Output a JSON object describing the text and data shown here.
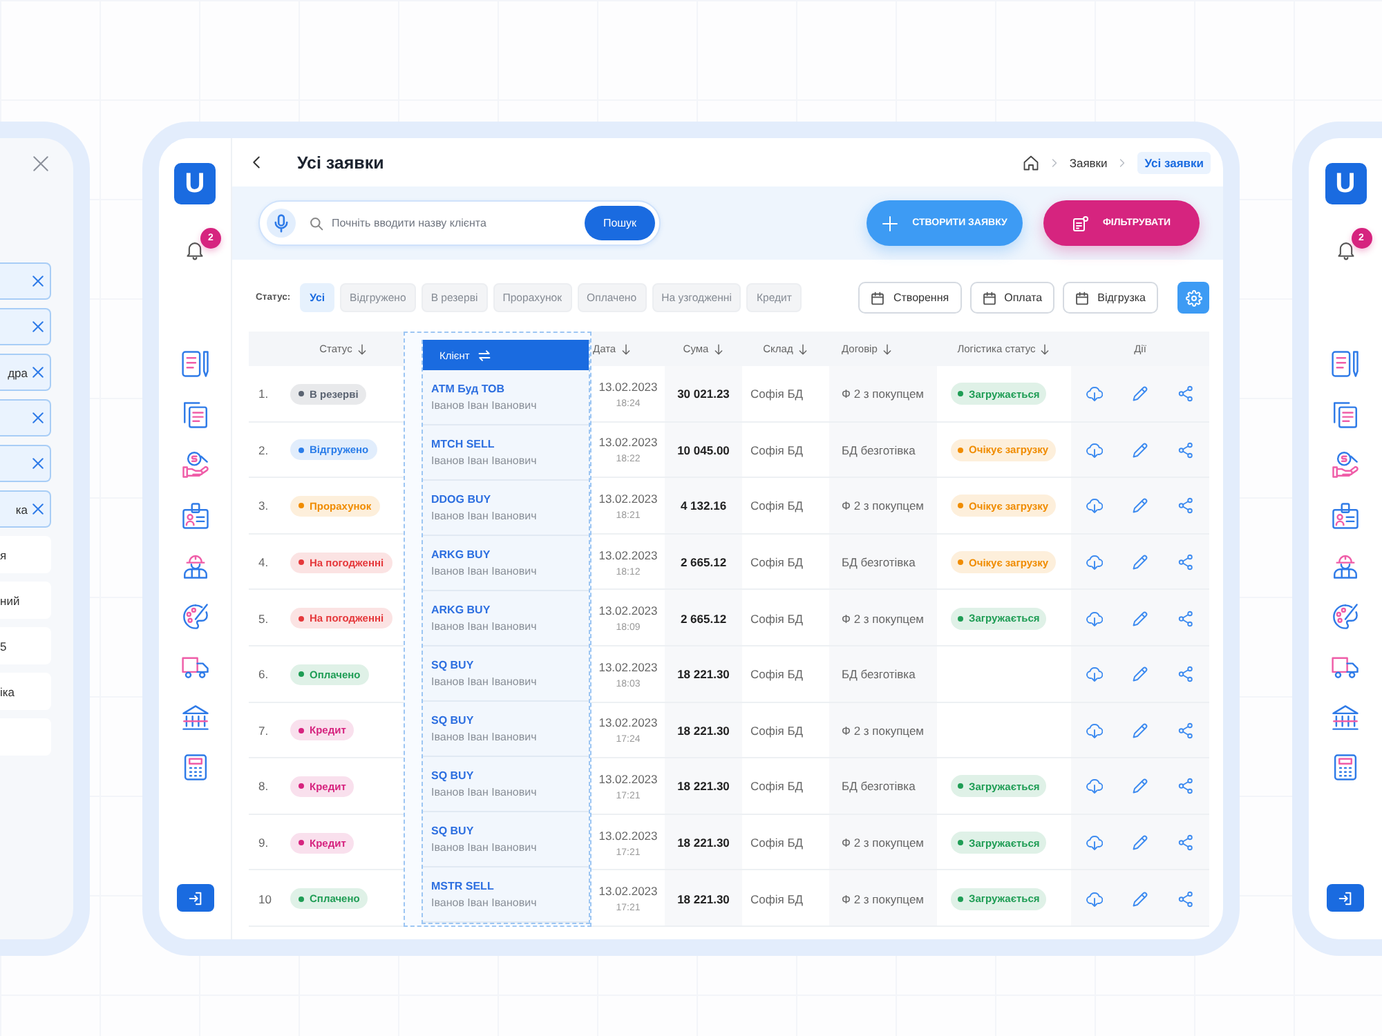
{
  "left_panel": {
    "options": [
      {
        "selected": true
      },
      {
        "selected": true
      },
      {
        "label": "дра",
        "selected": true
      },
      {
        "selected": true
      },
      {
        "selected": true
      },
      {
        "label": "ка",
        "selected": true
      },
      {
        "label": "я",
        "selected": false
      },
      {
        "label": "ний",
        "selected": false
      },
      {
        "label": "5",
        "selected": false
      },
      {
        "label": "іка",
        "selected": false
      },
      {
        "selected": false
      }
    ]
  },
  "sidebar": {
    "logo": "U",
    "notification_count": "2"
  },
  "header": {
    "title": "Усі заявки",
    "breadcrumbs": [
      {
        "label": "Заявки",
        "selected": false
      },
      {
        "label": "Усі заявки",
        "selected": true
      }
    ]
  },
  "search": {
    "placeholder": "Почніть вводити назву клієнта",
    "button": "Пошук"
  },
  "actions": [
    {
      "label": "СТВОРИТИ ЗАЯВКУ",
      "kind": "create"
    },
    {
      "label": "ФІЛЬТРУВАТИ",
      "kind": "filter"
    }
  ],
  "status_filter": {
    "label": "Статус:",
    "options": [
      {
        "label": "Усі",
        "selected": true
      },
      {
        "label": "Відгружено",
        "selected": false
      },
      {
        "label": "В резерві",
        "selected": false
      },
      {
        "label": "Прорахунок",
        "selected": false
      },
      {
        "label": "Оплачено",
        "selected": false
      },
      {
        "label": "На узгодженні",
        "selected": false
      },
      {
        "label": "Кредит",
        "selected": false
      }
    ]
  },
  "date_filters": [
    "Створення",
    "Оплата",
    "Відгрузка"
  ],
  "table": {
    "columns": [
      {
        "label": "Статус",
        "kind": "sort"
      },
      {
        "label": "Клієнт",
        "kind": "drag"
      },
      {
        "label": "Дата",
        "kind": "sort"
      },
      {
        "label": "Сума",
        "kind": "sort"
      },
      {
        "label": "Склад",
        "kind": "sort"
      },
      {
        "label": "Договір",
        "kind": "sort"
      },
      {
        "label": "Логістика статус",
        "kind": "sort"
      },
      {
        "label": "Дії",
        "kind": "plain"
      }
    ],
    "rows": [
      {
        "number": "1.",
        "status": {
          "label": "В резерві",
          "color": "#5b6472"
        },
        "client": "АТМ Буд ТОВ",
        "contact": "Іванов Іван Іванович",
        "date": "13.02.2023",
        "time": "18:24",
        "sum": "30 021.23",
        "warehouse": "Софія БД",
        "contract": "Ф 2 з покупцем",
        "logistics": {
          "label": "Загружається",
          "color": "#1f9d55"
        }
      },
      {
        "number": "2.",
        "status": {
          "label": "Відгружено",
          "color": "#2b7de9"
        },
        "client": "MTCH SELL",
        "contact": "Іванов Іван Іванович",
        "date": "13.02.2023",
        "time": "18:22",
        "sum": "10 045.00",
        "warehouse": "Софія БД",
        "contract": "БД безготівка",
        "logistics": {
          "label": "Очікує загрузку",
          "color": "#f08c00"
        }
      },
      {
        "number": "3.",
        "status": {
          "label": "Прорахунок",
          "color": "#f08c00"
        },
        "client": "DDOG BUY",
        "contact": "Іванов Іван Іванович",
        "date": "13.02.2023",
        "time": "18:21",
        "sum": "4 132.16",
        "warehouse": "Софія БД",
        "contract": "Ф 2 з покупцем",
        "logistics": {
          "label": "Очікує загрузку",
          "color": "#f08c00"
        }
      },
      {
        "number": "4.",
        "status": {
          "label": "На погодженні",
          "color": "#e5383b"
        },
        "client": "ARKG BUY",
        "contact": "Іванов Іван Іванович",
        "date": "13.02.2023",
        "time": "18:12",
        "sum": "2 665.12",
        "warehouse": "Софія БД",
        "contract": "БД безготівка",
        "logistics": {
          "label": "Очікує загрузку",
          "color": "#f08c00"
        }
      },
      {
        "number": "5.",
        "status": {
          "label": "На погодженні",
          "color": "#e5383b"
        },
        "client": "ARKG BUY",
        "contact": "Іванов Іван Іванович",
        "date": "13.02.2023",
        "time": "18:09",
        "sum": "2 665.12",
        "warehouse": "Софія БД",
        "contract": "Ф 2 з покупцем",
        "logistics": {
          "label": "Загружається",
          "color": "#1f9d55"
        }
      },
      {
        "number": "6.",
        "status": {
          "label": "Оплачено",
          "color": "#1f9d55"
        },
        "client": "SQ BUY",
        "contact": "Іванов Іван Іванович",
        "date": "13.02.2023",
        "time": "18:03",
        "sum": "18 221.30",
        "warehouse": "Софія БД",
        "contract": "БД безготівка"
      },
      {
        "number": "7.",
        "status": {
          "label": "Кредит",
          "color": "#d6247f"
        },
        "client": "SQ BUY",
        "contact": "Іванов Іван Іванович",
        "date": "13.02.2023",
        "time": "17:24",
        "sum": "18 221.30",
        "warehouse": "Софія БД",
        "contract": "Ф 2 з покупцем"
      },
      {
        "number": "8.",
        "status": {
          "label": "Кредит",
          "color": "#d6247f"
        },
        "client": "SQ BUY",
        "contact": "Іванов Іван Іванович",
        "date": "13.02.2023",
        "time": "17:21",
        "sum": "18 221.30",
        "warehouse": "Софія БД",
        "contract": "БД безготівка",
        "logistics": {
          "label": "Загружається",
          "color": "#1f9d55"
        }
      },
      {
        "number": "9.",
        "status": {
          "label": "Кредит",
          "color": "#d6247f"
        },
        "client": "SQ BUY",
        "contact": "Іванов Іван Іванович",
        "date": "13.02.2023",
        "time": "17:21",
        "sum": "18 221.30",
        "warehouse": "Софія БД",
        "contract": "Ф 2 з покупцем",
        "logistics": {
          "label": "Загружається",
          "color": "#1f9d55"
        }
      },
      {
        "number": "10",
        "status": {
          "label": "Сплачено",
          "color": "#1f9d55"
        },
        "client": "MSTR SELL",
        "contact": "Іванов Іван Іванович",
        "date": "13.02.2023",
        "time": "17:21",
        "sum": "18 221.30",
        "warehouse": "Софія БД",
        "contract": "Ф 2 з покупцем",
        "logistics": {
          "label": "Загружається",
          "color": "#1f9d55"
        }
      }
    ]
  },
  "right_screen": {
    "logo": "U",
    "notification_count": "2"
  }
}
